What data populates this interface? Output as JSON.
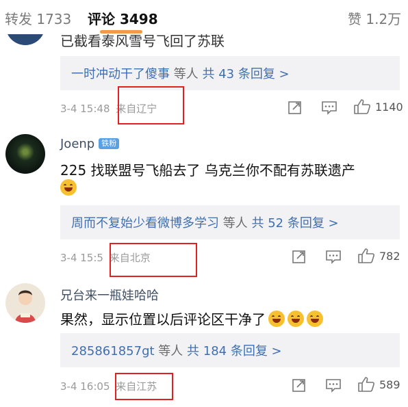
{
  "tabs": {
    "repost": "转发 1733",
    "comments": "评论 3498",
    "likes": "赞 1.2万"
  },
  "comments": [
    {
      "text": "已截看泰风雪号飞回了苏联",
      "replies": {
        "names": "一时冲动干了傻事",
        "mid": "等人",
        "count": "共 43 条回复 >"
      },
      "time": "3-4 15:48",
      "location": "来自辽宁",
      "likes": "1140"
    },
    {
      "author": "Joenp",
      "badge": "铁粉",
      "text": "225 找联盟号飞船去了 乌克兰你不配有苏联遗产",
      "replies": {
        "names": "周而不复始少看微博多学习",
        "mid": "等人",
        "count": "共 52 条回复 >"
      },
      "time": "3-4 15:5",
      "location": "来自北京",
      "likes": "782"
    },
    {
      "author": "兄台来一瓶娃哈哈",
      "text": "果然，显示位置以后评论区干净了",
      "replies": {
        "names": "285861857gt",
        "mid": "等人",
        "count": "共 184 条回复 >"
      },
      "time": "3-4 16:05",
      "location": "来自江苏",
      "likes": "589"
    }
  ],
  "icons": {
    "share": "share-icon",
    "comment": "comment-icon",
    "like": "like-icon"
  },
  "colors": {
    "accent": "#f29a49",
    "link": "#3f6fb1",
    "highlight_box": "#e12020"
  }
}
